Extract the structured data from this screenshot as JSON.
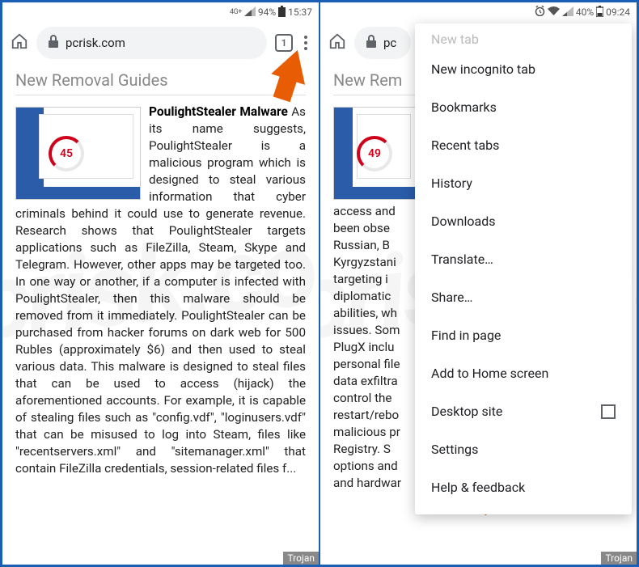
{
  "left": {
    "status": {
      "nettype": "4G+",
      "battery": "94%",
      "time": "15:37"
    },
    "url": "pcrisk.com",
    "tabs": "1",
    "section_title": "New Removal Guides",
    "article_title": "PoulightStealer Malware",
    "ring_value": "45",
    "article_body": "As its name suggests, PoulightStealer is a malicious program which is designed to steal various information that cyber criminals behind it could use to generate revenue. Research shows that PoulightStealer targets applications such as FileZilla, Steam, Skype and Telegram. However, other apps may be targeted too. In one way or another, if a computer is infected with PoulightStealer, then this malware should be removed from it immediately. PoulightStealer can be purchased from hacker forums on dark web for 500 Rubles (approximately $6) and then used to steal various data. This malware is designed to steal files that can be used to access (hijack) the aforementioned accounts. For example, it is capable of stealing files such as \"config.vdf\", \"loginusers.vdf\" that can be misused to log into Steam, files like \"recentservers.xml\" and \"sitemanager.xml\" that contain FileZilla credentials, session-related files f...",
    "tag": "Trojan"
  },
  "right": {
    "status": {
      "battery": "40%",
      "time": "09:24"
    },
    "url": "pc",
    "section_title": "New Rem",
    "ring_value": "49",
    "article_body": "access and been obse Russian, B Kyrgyzstani targeting i diplomatic abilities, wh issues. Som PlugX inclu personal file data exfiltra control the restart/rebo malicious pr Registry. S options and and hardwar",
    "tag": "Trojan",
    "menu": {
      "newtab_faded": "New tab",
      "items": [
        "New incognito tab",
        "Bookmarks",
        "Recent tabs",
        "History",
        "Downloads",
        "Translate…",
        "Share…",
        "Find in page",
        "Add to Home screen"
      ],
      "desktop": "Desktop site",
      "settings": "Settings",
      "help": "Help & feedback"
    }
  },
  "watermark": "pcrisk.com"
}
